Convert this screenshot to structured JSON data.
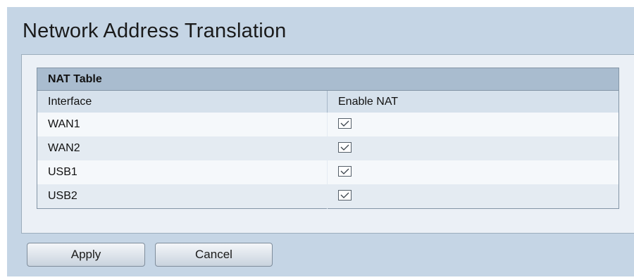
{
  "page": {
    "title": "Network Address Translation"
  },
  "nat_table": {
    "caption": "NAT Table",
    "columns": [
      "Interface",
      "Enable NAT"
    ],
    "rows": [
      {
        "interface": "WAN1",
        "enable_nat": true
      },
      {
        "interface": "WAN2",
        "enable_nat": true
      },
      {
        "interface": "USB1",
        "enable_nat": true
      },
      {
        "interface": "USB2",
        "enable_nat": true
      }
    ]
  },
  "actions": {
    "apply_label": "Apply",
    "cancel_label": "Cancel"
  },
  "colors": {
    "page_background": "#c5d5e5",
    "panel_background": "#ebf0f6",
    "table_caption": "#a9bccf",
    "table_header": "#d6e1ec"
  }
}
